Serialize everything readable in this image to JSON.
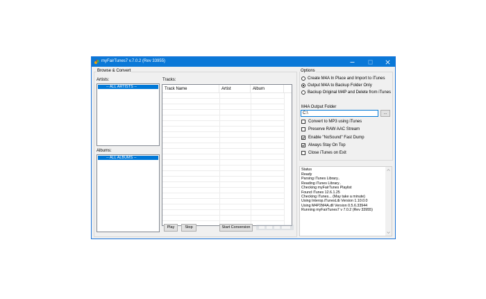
{
  "window": {
    "title": "myFairTunes7 v.7.0.2 (Rev 33955)"
  },
  "browse": {
    "group_label": "Browse & Convert",
    "artists_label": "Artists:",
    "artists_selected": "-- ALL ARTISTS --",
    "albums_label": "Albums:",
    "albums_selected": "-- ALL ALBUMS --",
    "tracks_label": "Tracks:",
    "columns": [
      "Track Name",
      "Artist",
      "Album"
    ],
    "play_label": "Play",
    "stop_label": "Stop",
    "convert_label": "Start Conversion"
  },
  "options": {
    "group_label": "Options",
    "radios": [
      {
        "label": "Create M4A In Place and Import to iTunes",
        "selected": false
      },
      {
        "label": "Output M4A to Backup Folder Only",
        "selected": true
      },
      {
        "label": "Backup Original M4P and Delete from iTunes",
        "selected": false
      }
    ],
    "output_folder_label": "M4A Output Folder",
    "output_folder_value": "C:\\",
    "browse_label": "...",
    "checkboxes": [
      {
        "label": "Convert to MP3 using iTunes",
        "checked": false
      },
      {
        "label": "Preserve RAW AAC Stream",
        "checked": false
      },
      {
        "label": "Enable \"NoSound\" Fast Dump",
        "checked": true
      },
      {
        "label": "Always Stay On Top",
        "checked": true
      },
      {
        "label": "Close iTunes on Exit",
        "checked": false
      }
    ]
  },
  "status": {
    "label": "Status",
    "lines": [
      "Ready",
      "Parsing iTunes Library..",
      "Reading iTunes Library..",
      "Checking myFairTunes Playlist",
      "Found iTunes 12.6.1.25",
      "Checking iTunes... (May take a minute)",
      "Using Interop.iTunesLib Version 1.10.0.0",
      "Using M4P2M4A.dll Version 0.5.6.33944",
      "Running myFairTunes7 v 7.0.2 (Rev 33955)"
    ]
  },
  "colors": {
    "titlebar": "#0a78d7",
    "selection": "#0078d7",
    "window_bg": "#f0f0f0"
  }
}
